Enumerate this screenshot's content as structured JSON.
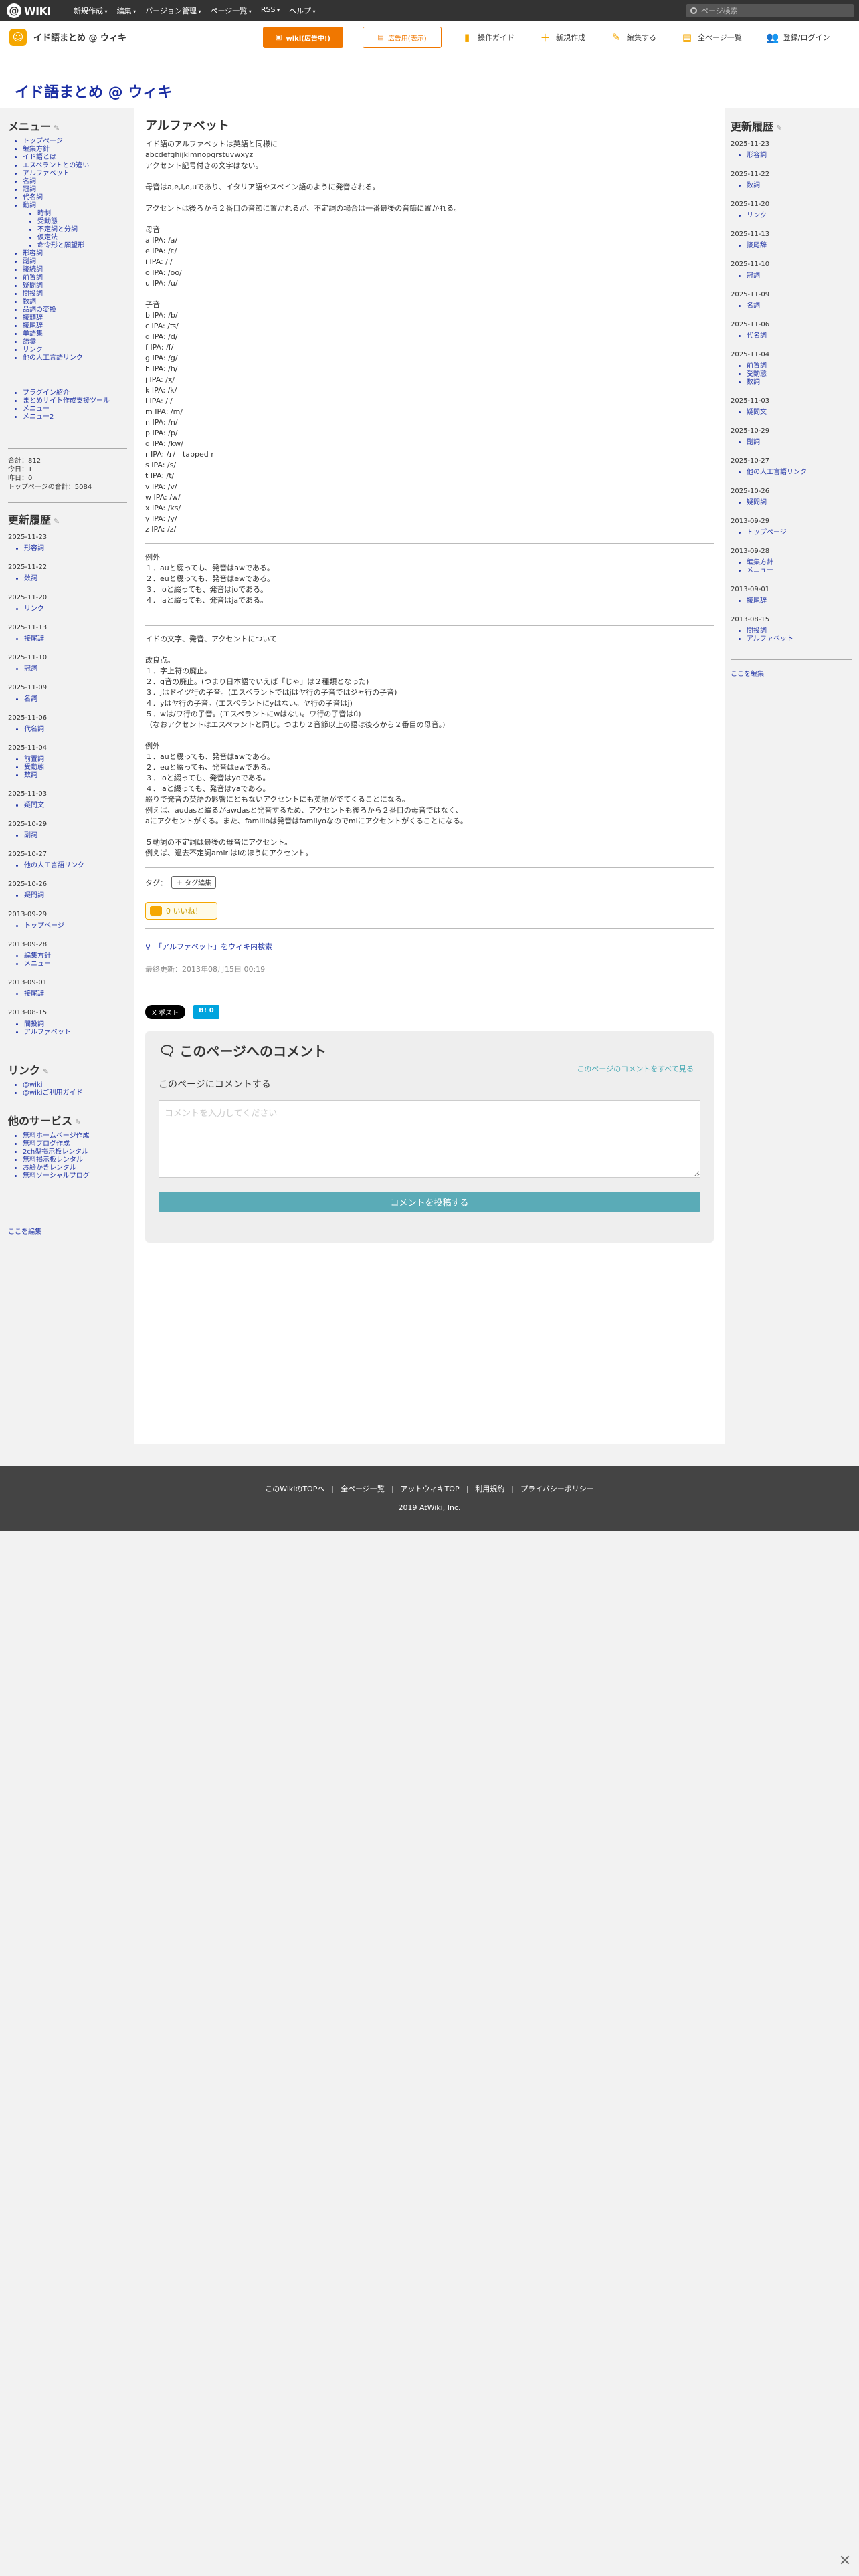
{
  "topbar": {
    "logo_text": "WIKI",
    "menu": [
      "新規作成",
      "編集",
      "バージョン管理",
      "ページ一覧",
      "RSS",
      "ヘルプ"
    ],
    "search_placeholder": "ページ検索"
  },
  "subbar": {
    "site_name": "イド語まとめ @ ウィキ",
    "btn_ad_free": "wiki(広告中!)",
    "btn_ad_manage": "広告用(表示)",
    "nav": [
      "操作ガイド",
      "新規作成",
      "編集する",
      "全ページ一覧",
      "登録/ログイン"
    ]
  },
  "wiki_title": "イド語まとめ @ ウィキ",
  "left": {
    "menu_title": "メニュー",
    "menu_items": [
      "トップページ",
      "編集方針",
      "イド語とは",
      "エスペラントとの違い",
      "アルファベット",
      "名詞",
      "冠詞",
      "代名詞",
      "動詞"
    ],
    "verb_sub": [
      "時制",
      "受動態",
      "不定詞と分詞",
      "仮定法",
      "命令形と願望形"
    ],
    "menu_items2": [
      "形容詞",
      "副詞",
      "接続詞",
      "前置詞",
      "疑問詞",
      "間投詞",
      "数詞",
      "品詞の変換",
      "接頭辞",
      "接尾辞",
      "単語集",
      "語彙",
      "リンク",
      "他の人工言語リンク"
    ],
    "tools": [
      "プラグイン紹介",
      "まとめサイト作成支援ツール",
      "メニュー",
      "メニュー2"
    ],
    "counter": [
      "合計：812",
      "今日：1",
      "昨日：0",
      "トップページの合計：5084"
    ],
    "recent_title": "更新履歴",
    "recent": [
      {
        "date": "2025-11-23",
        "items": [
          "形容詞"
        ]
      },
      {
        "date": "2025-11-22",
        "items": [
          "数詞"
        ]
      },
      {
        "date": "2025-11-20",
        "items": [
          "リンク"
        ]
      },
      {
        "date": "2025-11-13",
        "items": [
          "接尾辞"
        ]
      },
      {
        "date": "2025-11-10",
        "items": [
          "冠詞"
        ]
      },
      {
        "date": "2025-11-09",
        "items": [
          "名詞"
        ]
      },
      {
        "date": "2025-11-06",
        "items": [
          "代名詞"
        ]
      },
      {
        "date": "2025-11-04",
        "items": [
          "前置詞",
          "受動態",
          "数詞"
        ]
      },
      {
        "date": "2025-11-03",
        "items": [
          "疑問文"
        ]
      },
      {
        "date": "2025-10-29",
        "items": [
          "副詞"
        ]
      },
      {
        "date": "2025-10-27",
        "items": [
          "他の人工言語リンク"
        ]
      },
      {
        "date": "2025-10-26",
        "items": [
          "疑問詞"
        ]
      },
      {
        "date": "2013-09-29",
        "items": [
          "トップページ"
        ]
      },
      {
        "date": "2013-09-28",
        "items": [
          "編集方針",
          "メニュー"
        ]
      },
      {
        "date": "2013-09-01",
        "items": [
          "接尾辞"
        ]
      },
      {
        "date": "2013-08-15",
        "items": [
          "間投詞",
          "アルファベット"
        ]
      }
    ],
    "links_title": "リンク",
    "links": [
      "@wiki",
      "@wikiご利用ガイド"
    ],
    "services_title": "他のサービス",
    "services": [
      "無料ホームページ作成",
      "無料ブログ作成",
      "2ch型掲示板レンタル",
      "無料掲示板レンタル",
      "お絵かきレンタル",
      "無料ソーシャルプログ"
    ],
    "edit_here": "ここを編集"
  },
  "main": {
    "title": "アルファベット",
    "paragraphs": [
      "イド語のアルファベットは英語と同様に",
      "abcdefghijklmnopqrstuvwxyz",
      "アクセント記号付きの文字はない。",
      "",
      "母音はa,e,i,o,uであり、イタリア語やスペイン語のように発音される。",
      "",
      "アクセントは後ろから２番目の音節に置かれるが、不定詞の場合は一番最後の音節に置かれる。",
      "",
      "母音",
      "a IPA: /a/",
      "e IPA: /ɛ/",
      "i IPA: /i/",
      "o IPA: /oo/",
      "u IPA: /u/",
      "",
      "子音",
      "b IPA: /b/",
      "c IPA: /ʦ/",
      "d IPA: /d/",
      "f IPA: /f/",
      "g IPA: /g/",
      "h IPA: /h/",
      "j IPA: /ʒ/",
      "k IPA: /k/",
      "l IPA: /l/",
      "m IPA: /m/",
      "n IPA: /n/",
      "p IPA: /p/",
      "q IPA: /kw/",
      "r IPA: /ɾ/　tapped r",
      "s IPA: /s/",
      "t IPA: /t/",
      "v IPA: /v/",
      "w IPA: /w/",
      "x IPA: /ks/",
      "y IPA: /y/",
      "z IPA: /z/"
    ],
    "block2": [
      "例外",
      "１．auと綴っても、発音はawである。",
      "２．euと綴っても、発音はewである。",
      "３．ioと綴っても、発音はjoである。",
      "４．iaと綴っても、発音はjaである。"
    ],
    "block3": [
      "イドの文字、発音、アクセントについて",
      "",
      "改良点。",
      "１．字上符の廃止。",
      "２．g音の廃止。(つまり日本語でいえば「じゃ」は２種類となった)",
      "３．jはドイツ行の子音。(エスペラントではjはヤ行の子音ではジャ行の子音)",
      "４．yはヤ行の子音。(エスペラントにyはない。ヤ行の子音はj)",
      "５．wは/ワ行の子音。(エスペラントにwはない。ワ行の子音はŭ)",
      "（なおアクセントはエスペラントと同じ。つまり２音節以上の語は後ろから２番目の母音。)",
      "",
      "例外",
      "１．auと綴っても、発音はawである。",
      "２．euと綴っても、発音はewである。",
      "３．ioと綴っても、発音はyoである。",
      "４．iaと綴っても、発音はyaである。",
      "綴りで発音の英語の影響にともないアクセントにも英語がでてくることになる。",
      "例えば、audasと綴るがawdasと発音するため、アクセントも後ろから２番目の母音ではなく、",
      "aにアクセントがくる。また、familioは発音はfamilyoなのでmiにアクセントがくることになる。",
      "",
      "５動詞の不定詞は最後の母音にアクセント。",
      "例えば、過去不定詞amiriはiのほうにアクセント。"
    ],
    "tags_label": "タグ：",
    "tag_edit": "＋ タグ編集",
    "like": "0 いいね！",
    "search_link": "「アルファベット」をウィキ内検索",
    "last_update": "最終更新：2013年08月15日 00:19",
    "social_x": "X ポスト",
    "social_hatena": "B! 0"
  },
  "comment": {
    "title": "このページへのコメント",
    "see_all": "このページのコメントをすべて見る",
    "subtitle": "このページにコメントする",
    "placeholder": "コメントを入力してください",
    "submit": "コメントを投稿する"
  },
  "right": {
    "recent_title": "更新履歴",
    "edit_here": "ここを編集"
  },
  "footer": {
    "links": [
      "このWikiのTOPへ",
      "全ページ一覧",
      "アットウィキTOP",
      "利用規約",
      "プライバシーポリシー"
    ],
    "copyright": "2019 AtWiki, Inc."
  }
}
